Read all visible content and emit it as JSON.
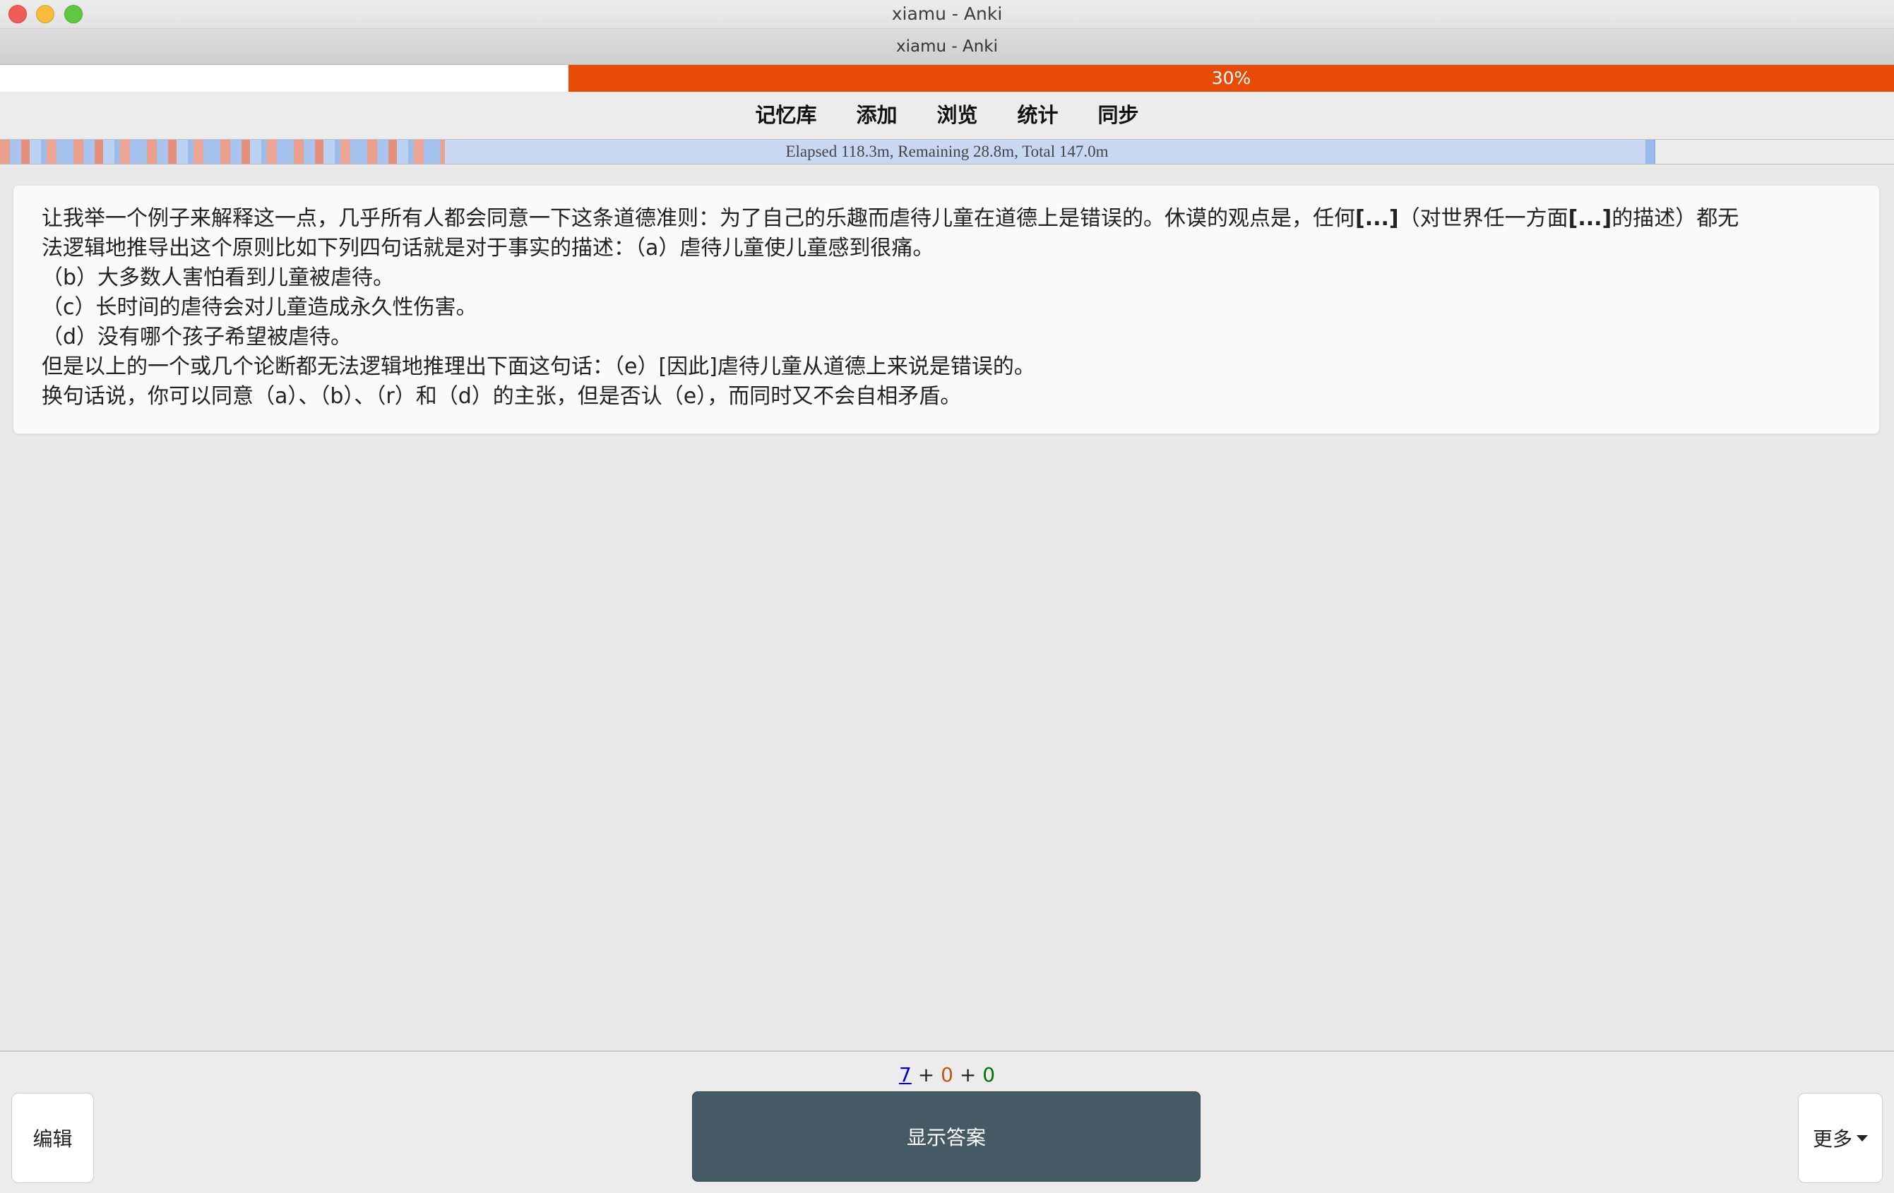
{
  "os_window": {
    "title": "xiamu - Anki"
  },
  "window": {
    "title": "xiamu - Anki"
  },
  "progress": {
    "label": "30%",
    "fraction": 0.7,
    "color": "#e84b06"
  },
  "nav": {
    "items": [
      "记忆库",
      "添加",
      "浏览",
      "统计",
      "同步"
    ]
  },
  "timebar": {
    "text": "Elapsed 118.3m, Remaining 28.8m, Total 147.0m"
  },
  "card": {
    "line1_a": "让我举一个例子来解释这一点，几乎所有人都会同意一下这条道德准则：为了自己的乐趣而虐待儿童在道德上是错误的。休谟的观点是，任何",
    "line1_b": "[...]",
    "line1_c": "（对世界任一方面",
    "line1_d": "[...]",
    "line1_e": "的描述）都无",
    "line2": "法逻辑地推导出这个原则比如下列四句话就是对于事实的描述：（a）虐待儿童使儿童感到很痛。",
    "line3": "（b）大多数人害怕看到儿童被虐待。",
    "line4": "（c）长时间的虐待会对儿童造成永久性伤害。",
    "line5": "（d）没有哪个孩子希望被虐待。",
    "line6": "但是以上的一个或几个论断都无法逻辑地推理出下面这句话：（e）[因此]虐待儿童从道德上来说是错误的。",
    "line7": "换句话说，你可以同意（a）、（b）、（r）和（d）的主张，但是否认（e），而同时又不会自相矛盾。"
  },
  "counts": {
    "new": "7",
    "plus1": "+",
    "learning": "0",
    "plus2": "+",
    "review": "0",
    "colors": {
      "new": "#0000cc",
      "learning": "#c35617",
      "review": "#007700"
    }
  },
  "buttons": {
    "edit": "编辑",
    "show_answer": "显示答案",
    "more": "更多"
  }
}
